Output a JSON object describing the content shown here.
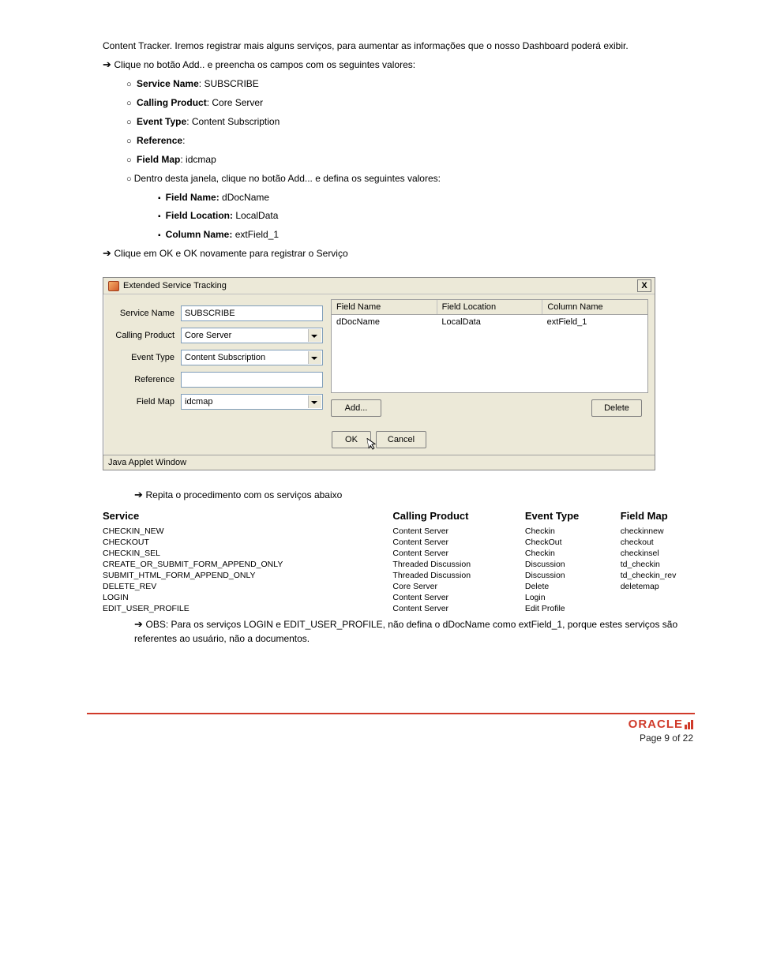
{
  "intro1": "Content Tracker. Iremos registrar mais alguns serviços, para aumentar as informações que o nosso Dashboard poderá exibir.",
  "step_add": "Clique no botão Add.. e preencha os campos com os seguintes valores:",
  "fields": {
    "service_name_lbl": "Service Name",
    "service_name_val": ": SUBSCRIBE",
    "calling_product_lbl": "Calling Product",
    "calling_product_val": ": Core Server",
    "event_type_lbl": "Event Type",
    "event_type_val": ": Content Subscription",
    "reference_lbl": "Reference",
    "reference_val": ":",
    "field_map_lbl": "Field Map",
    "field_map_val": ": idcmap",
    "nested": "Dentro desta janela, clique no botão Add... e defina os seguintes valores:",
    "fn_lbl": "Field Name:",
    "fn_val": " dDocName",
    "fl_lbl": "Field Location:",
    "fl_val": " LocalData",
    "cn_lbl": "Column Name:",
    "cn_val": " extField_1"
  },
  "after": "Clique em OK e OK novamente para registrar o Serviço",
  "dialog": {
    "title": "Extended Service Tracking",
    "labels": {
      "service_name": "Service Name",
      "calling_product": "Calling Product",
      "event_type": "Event Type",
      "reference": "Reference",
      "field_map": "Field Map"
    },
    "values": {
      "service_name": "SUBSCRIBE",
      "calling_product": "Core Server",
      "event_type": "Content Subscription",
      "reference": "",
      "field_map": "idcmap"
    },
    "grid_headers": {
      "c1": "Field Name",
      "c2": "Field Location",
      "c3": "Column Name"
    },
    "grid_row": {
      "c1": "dDocName",
      "c2": "LocalData",
      "c3": "extField_1"
    },
    "buttons": {
      "add": "Add...",
      "delete": "Delete",
      "ok": "OK",
      "cancel": "Cancel"
    },
    "status": "Java Applet Window"
  },
  "repeat": "Repita o procedimento com os serviços abaixo",
  "table": {
    "h1": "Service",
    "h2": "Calling Product",
    "h3": "Event Type",
    "h4": "Field Map",
    "rows": [
      {
        "s": "CHECKIN_NEW",
        "cp": "Content Server",
        "et": "Checkin",
        "fm": "checkinnew"
      },
      {
        "s": "CHECKOUT",
        "cp": "Content Server",
        "et": "CheckOut",
        "fm": "checkout"
      },
      {
        "s": "CHECKIN_SEL",
        "cp": "Content Server",
        "et": "Checkin",
        "fm": "checkinsel"
      },
      {
        "s": "CREATE_OR_SUBMIT_FORM_APPEND_ONLY",
        "cp": "Threaded Discussion",
        "et": "Discussion",
        "fm": "td_checkin"
      },
      {
        "s": "SUBMIT_HTML_FORM_APPEND_ONLY",
        "cp": "Threaded Discussion",
        "et": "Discussion",
        "fm": "td_checkin_rev"
      },
      {
        "s": "DELETE_REV",
        "cp": "Core Server",
        "et": "Delete",
        "fm": "deletemap"
      },
      {
        "s": "LOGIN",
        "cp": "Content Server",
        "et": "Login",
        "fm": ""
      },
      {
        "s": "EDIT_USER_PROFILE",
        "cp": "Content Server",
        "et": "Edit Profile",
        "fm": ""
      }
    ]
  },
  "obs": "OBS: Para os serviços LOGIN e EDIT_USER_PROFILE, não defina o dDocName como extField_1, porque estes serviços são referentes ao usuário, não a documentos.",
  "footer": {
    "brand": "ORACLE",
    "page": "Page 9 of 22"
  }
}
